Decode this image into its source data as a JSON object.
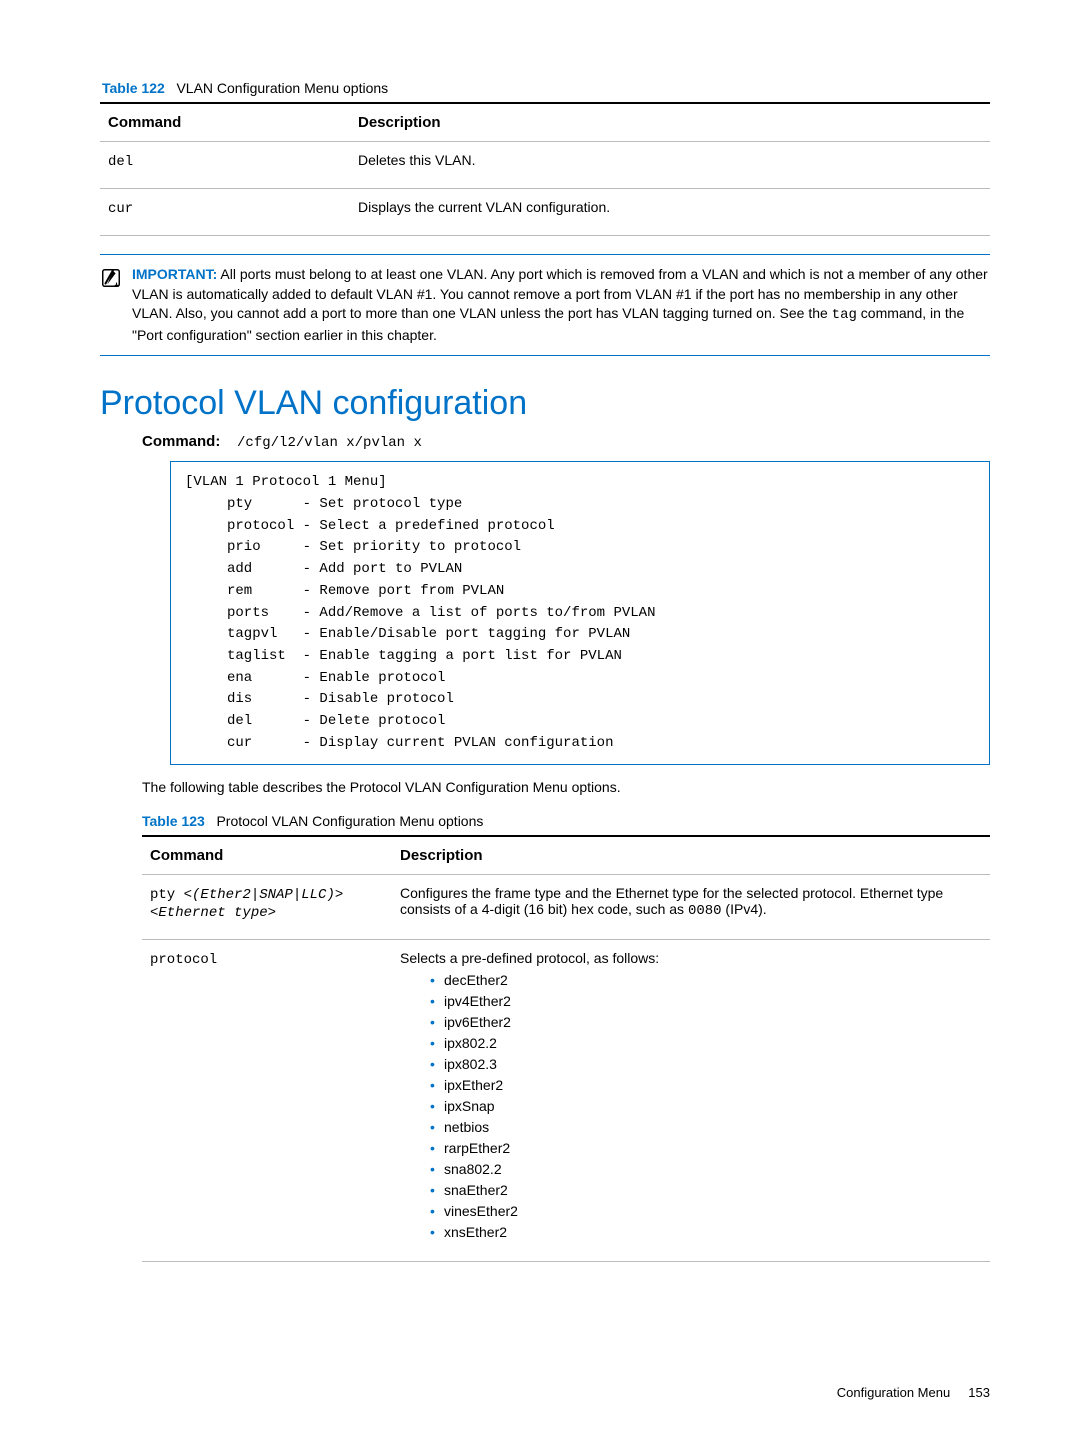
{
  "table122": {
    "label": "Table 122",
    "title": "VLAN Configuration Menu options",
    "col_cmd": "Command",
    "col_desc": "Description",
    "rows": [
      {
        "cmd": "del",
        "desc": "Deletes this VLAN."
      },
      {
        "cmd": "cur",
        "desc": "Displays the current VLAN configuration."
      }
    ]
  },
  "important": {
    "lead": "IMPORTANT:",
    "text_before_tag": " All ports must belong to at least one VLAN. Any port which is removed from a VLAN and which is not a member of any other VLAN is automatically added to default VLAN #1. You cannot remove a port from VLAN #1 if the port has no membership in any other VLAN. Also, you cannot add a port to more than one VLAN unless the port has VLAN tagging turned on. See the ",
    "tag_word": "tag",
    "text_after_tag": " command, in the \"Port configuration\" section earlier in this chapter."
  },
  "section_heading": "Protocol VLAN configuration",
  "command_line": {
    "label": "Command:",
    "value": "/cfg/l2/vlan x/pvlan x"
  },
  "codebox": "[VLAN 1 Protocol 1 Menu]\n     pty      - Set protocol type\n     protocol - Select a predefined protocol\n     prio     - Set priority to protocol\n     add      - Add port to PVLAN\n     rem      - Remove port from PVLAN\n     ports    - Add/Remove a list of ports to/from PVLAN\n     tagpvl   - Enable/Disable port tagging for PVLAN\n     taglist  - Enable tagging a port list for PVLAN\n     ena      - Enable protocol\n     dis      - Disable protocol\n     del      - Delete protocol\n     cur      - Display current PVLAN configuration",
  "intro_table123": "The following table describes the Protocol VLAN Configuration Menu options.",
  "table123": {
    "label": "Table 123",
    "title": "Protocol VLAN Configuration Menu options",
    "col_cmd": "Command",
    "col_desc": "Description",
    "row_pty": {
      "cmd_a": "pty <",
      "cmd_b": "(Ether2|SNAP|LLC)",
      "cmd_c": "> <",
      "cmd_d": "Ethernet type",
      "cmd_e": ">",
      "desc_a": "Configures the frame type and the Ethernet type for the selected protocol. Ethernet type consists of a 4-digit (16 bit) hex code, such as ",
      "desc_code": "0080",
      "desc_b": " (IPv4)."
    },
    "row_protocol": {
      "cmd": "protocol",
      "desc_lead": "Selects a pre-defined protocol, as follows:",
      "items": [
        "decEther2",
        "ipv4Ether2",
        "ipv6Ether2",
        "ipx802.2",
        "ipx802.3",
        "ipxEther2",
        "ipxSnap",
        "netbios",
        "rarpEther2",
        "sna802.2",
        "snaEther2",
        "vinesEther2",
        "xnsEther2"
      ]
    }
  },
  "footer": {
    "section": "Configuration Menu",
    "page": "153"
  }
}
